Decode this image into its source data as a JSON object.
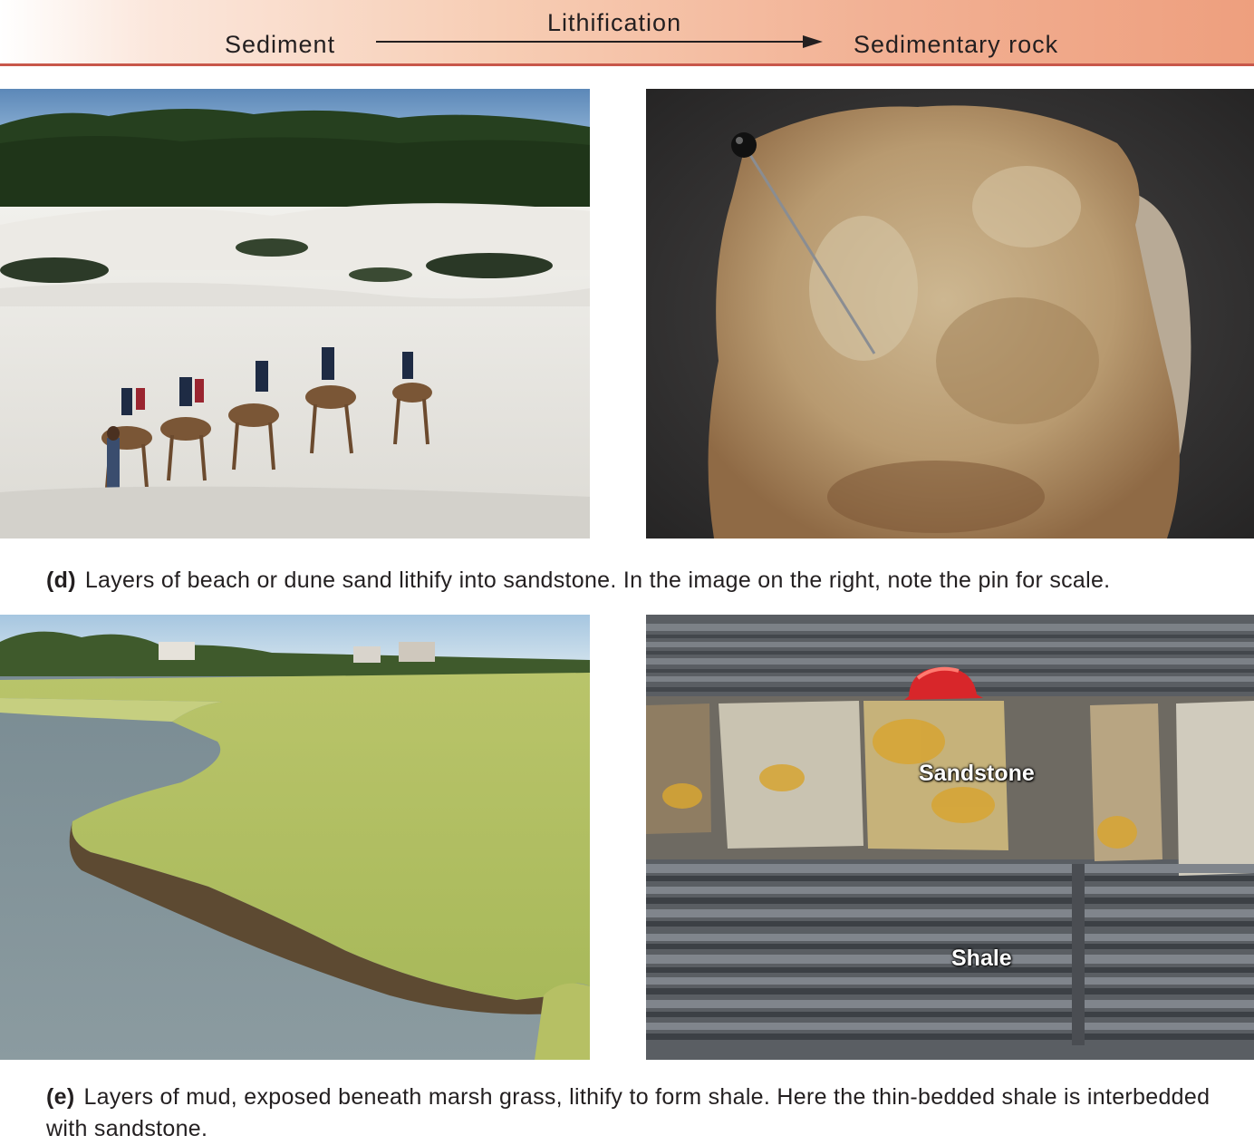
{
  "header": {
    "left_label": "Sediment",
    "process_label": "Lithification",
    "right_label": "Sedimentary rock",
    "arrow_icon": "right-arrow-icon",
    "gradient_start": "#ffffff",
    "gradient_end": "#ee9f7e",
    "rule_color": "#c8574a"
  },
  "panel_d": {
    "tag": "(d)",
    "caption": "Layers of beach or dune sand lithify into sandstone. In the image on the right, note the pin for scale."
  },
  "panel_e": {
    "tag": "(e)",
    "caption": "Layers of mud, exposed beneath marsh grass, lithify to form shale. Here the thin-bedded shale is interbedded with sandstone.",
    "labels": {
      "sandstone": "Sandstone",
      "shale": "Shale"
    }
  }
}
